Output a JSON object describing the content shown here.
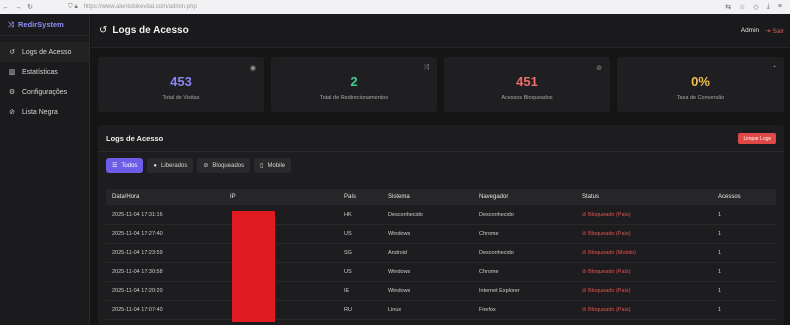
{
  "browser": {
    "back": "←",
    "forward": "→",
    "reload": "↻",
    "url": "https://www.alentobikevital.com/admin.php"
  },
  "sidebar": {
    "brand": "RedirSystem",
    "items": [
      {
        "label": "Logs de Acesso",
        "icon": "history-icon"
      },
      {
        "label": "Estatísticas",
        "icon": "bar-chart-icon"
      },
      {
        "label": "Configurações",
        "icon": "gear-icon"
      },
      {
        "label": "Lista Negra",
        "icon": "block-icon"
      }
    ]
  },
  "header": {
    "title": "Logs de Acesso",
    "user": "Admin",
    "logout": "Sair"
  },
  "stats": [
    {
      "value": "453",
      "label": "Total de Visitas",
      "color": "#8a86f3",
      "icon": "eye-icon"
    },
    {
      "value": "2",
      "label": "Total de Redirecionamentos",
      "color": "#3ecf8e",
      "icon": "shuffle-icon"
    },
    {
      "value": "451",
      "label": "Acessos Bloqueados",
      "color": "#f06b6b",
      "icon": "ban-icon"
    },
    {
      "value": "0%",
      "label": "Taxa de Conversão",
      "color": "#f2c14e",
      "icon": "pie-chart-icon"
    }
  ],
  "logs": {
    "title": "Logs de Acesso",
    "clear_button": "Limpar Logs",
    "filters": [
      "Todos",
      "Liberados",
      "Bloqueados",
      "Mobile"
    ],
    "columns": [
      "Data/Hora",
      "IP",
      "País",
      "Sistema",
      "Navegador",
      "Status",
      "Acessos"
    ],
    "rows": [
      {
        "date": "2025-11-04 17:31:16",
        "country": "HK",
        "system": "Desconhecido",
        "browser": "Desconhecido",
        "status": "Bloqueado (País)",
        "count": "1"
      },
      {
        "date": "2025-11-04 17:27:40",
        "country": "US",
        "system": "Windows",
        "browser": "Chrome",
        "status": "Bloqueado (País)",
        "count": "1"
      },
      {
        "date": "2025-11-04 17:23:59",
        "country": "SG",
        "system": "Android",
        "browser": "Desconhecido",
        "status": "Bloqueado (Mobile)",
        "count": "1"
      },
      {
        "date": "2025-11-04 17:30:58",
        "country": "US",
        "system": "Windows",
        "browser": "Chrome",
        "status": "Bloqueado (País)",
        "count": "1"
      },
      {
        "date": "2025-11-04 17:20:20",
        "country": "IE",
        "system": "Windows",
        "browser": "Internet Explorer",
        "status": "Bloqueado (País)",
        "count": "1"
      },
      {
        "date": "2025-11-04 17:07:40",
        "country": "RU",
        "system": "Linux",
        "browser": "Firefox",
        "status": "Bloqueado (País)",
        "count": "1"
      }
    ]
  }
}
